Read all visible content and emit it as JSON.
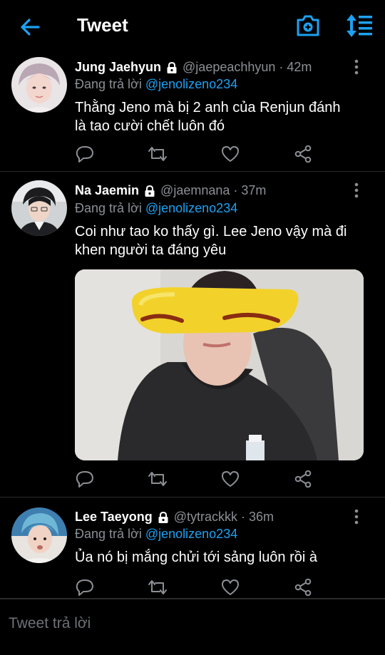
{
  "header": {
    "title": "Tweet",
    "back_icon": "arrow-left-icon",
    "camera_icon": "camera-icon",
    "sort_icon": "sort-icon",
    "accent": "#1da1f2"
  },
  "tweets": [
    {
      "name": "Jung Jaehyun",
      "handle": "@jaepeachhyun · 42m",
      "reply_prefix": "Đang trả lời ",
      "reply_to": "@jenolizeno234",
      "text_line1": "Thằng Jeno mà bị 2 anh của Renjun đánh",
      "text_line2": "là tao cười chết luôn đó"
    },
    {
      "name": "Na Jaemin",
      "handle": "@jaemnana · 37m",
      "reply_prefix": "Đang trả lời ",
      "reply_to": "@jenolizeno234",
      "text_line1": "Coi như tao ko thấy gì. Lee Jeno vậy mà đi",
      "text_line2": "khen người ta đáng yêu"
    },
    {
      "name": "Lee Taeyong",
      "handle": "@tytrackkk · 36m",
      "reply_prefix": "Đang trả lời ",
      "reply_to": "@jenolizeno234",
      "text_line1": "Ủa nó bị mắng chửi tới sảng luôn rồi à"
    }
  ],
  "reply_bar": {
    "placeholder": "Tweet trả lời"
  }
}
